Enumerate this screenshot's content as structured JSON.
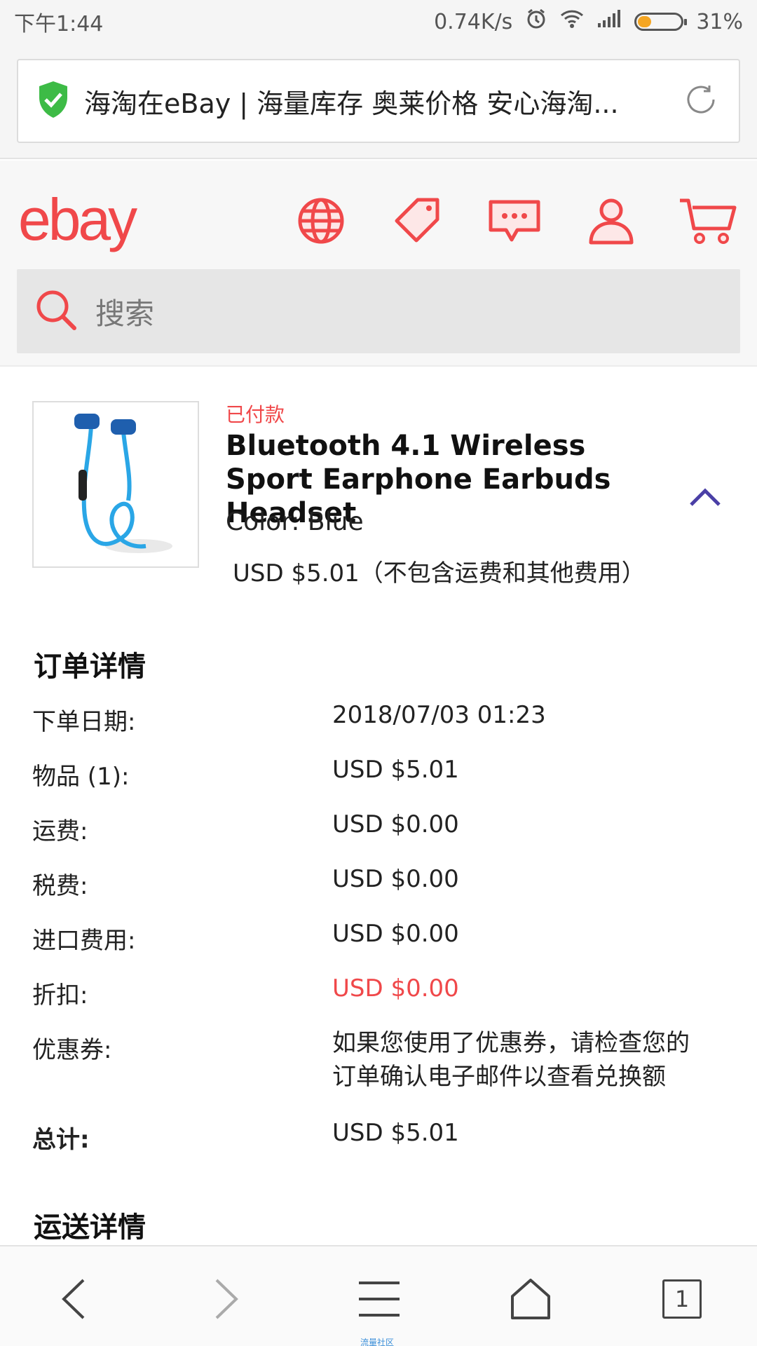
{
  "status": {
    "time": "下午1:44",
    "speed": "0.74K/s",
    "battery": "31%",
    "battery_level": 0.31
  },
  "url_bar": {
    "title": "海淘在eBay | 海量库存 奥莱价格 安心海淘..."
  },
  "header": {
    "logo": "ebay"
  },
  "search": {
    "placeholder": "搜索"
  },
  "product": {
    "status": "已付款",
    "title": "Bluetooth 4.1 Wireless Sport Earphone Earbuds Headset",
    "color": "Color: Blue",
    "price": "USD $5.01（不包含运费和其他费用）"
  },
  "order": {
    "title": "订单详情",
    "rows": [
      {
        "label": "下单日期:",
        "value": "2018/07/03 01:23"
      },
      {
        "label": "物品 (1):",
        "value": "USD $5.01"
      },
      {
        "label": "运费:",
        "value": "USD $0.00"
      },
      {
        "label": "税费:",
        "value": "USD $0.00"
      },
      {
        "label": "进口费用:",
        "value": "USD $0.00"
      },
      {
        "label": "折扣:",
        "value": "USD $0.00"
      },
      {
        "label": "优惠券:",
        "value": "如果您使用了优惠券，请检查您的订单确认电子邮件以查看兑换额"
      },
      {
        "label": "总计:",
        "value": "USD $5.01"
      }
    ]
  },
  "shipping": {
    "title": "运送详情"
  },
  "bottom_nav": {
    "tab_count": "1",
    "tag": "流量社区"
  },
  "colors": {
    "brand": "#f0484a",
    "accent": "#4a3fa6"
  }
}
